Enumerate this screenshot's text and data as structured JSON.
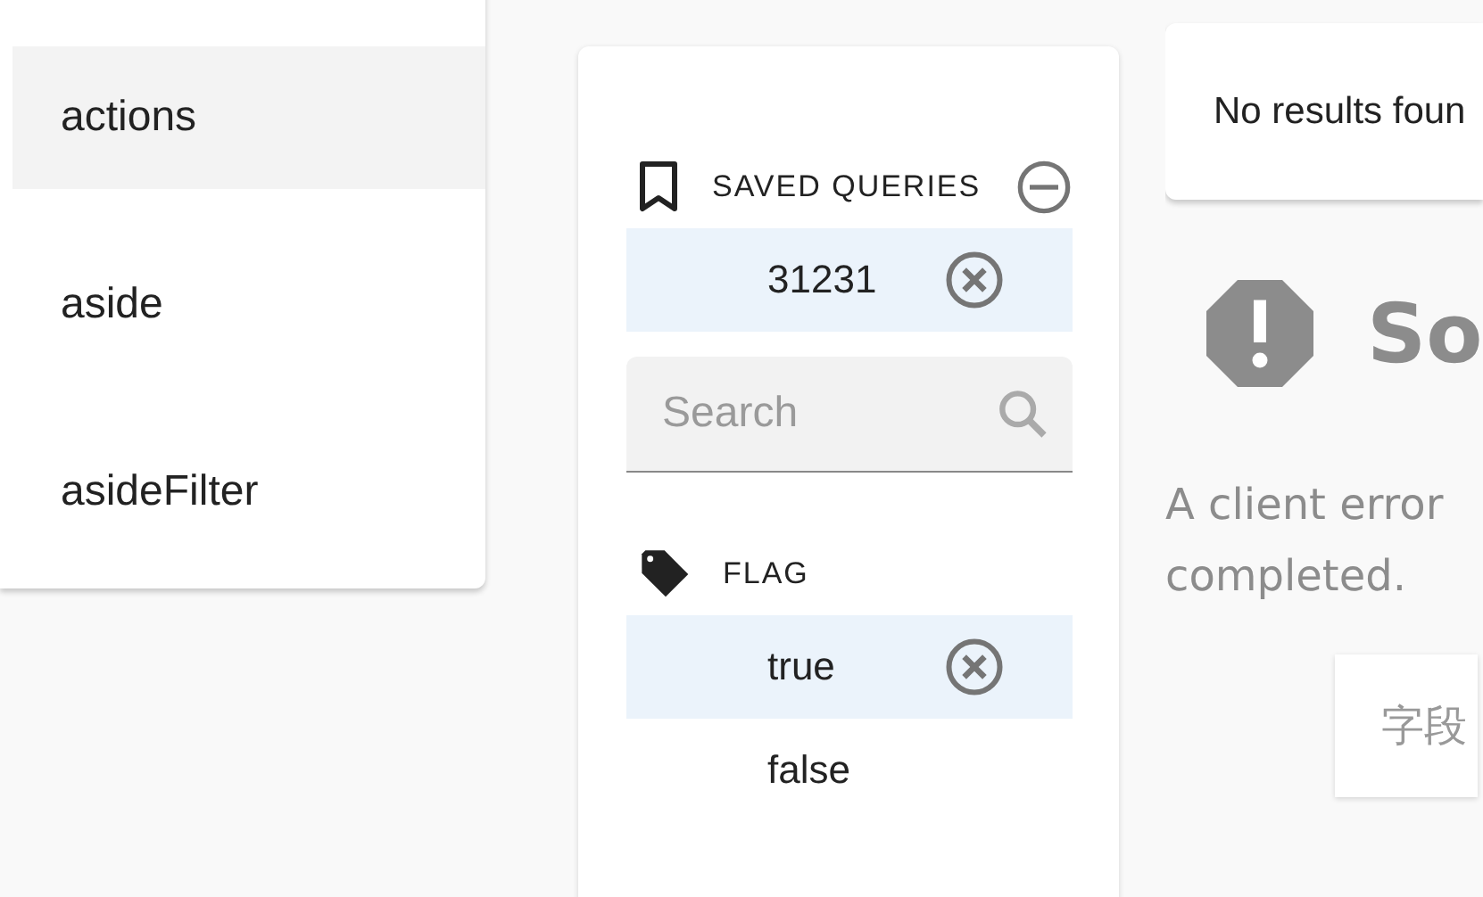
{
  "menu": {
    "items": [
      {
        "label": "actions",
        "selected": true
      },
      {
        "label": "aside",
        "selected": false
      },
      {
        "label": "asideFilter",
        "selected": false
      }
    ]
  },
  "filters": {
    "saved_queries": {
      "title": "SAVED QUERIES",
      "items": [
        {
          "label": "31231",
          "selected": true
        }
      ]
    },
    "search": {
      "placeholder": "Search"
    },
    "flag": {
      "title": "FLAG",
      "items": [
        {
          "label": "true",
          "selected": true
        },
        {
          "label": "false",
          "selected": false
        }
      ]
    }
  },
  "results": {
    "message": "No results foun"
  },
  "error": {
    "title": "So",
    "lines": [
      "A client error",
      "completed."
    ],
    "button": "字段"
  }
}
